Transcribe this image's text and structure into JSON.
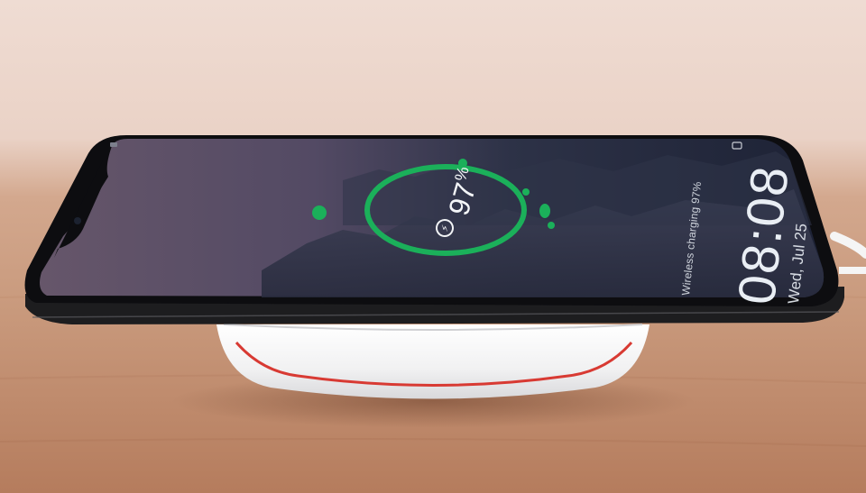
{
  "lockscreen": {
    "charge_percent": "97",
    "percent_sign": "%",
    "charging_text": "Wireless charging 97%",
    "time": "08:08",
    "date": "Wed, Jul 25"
  },
  "icons": [
    "lightning-bolt-icon",
    "camera-icon"
  ],
  "colors": {
    "ring": "#1bb05a",
    "charger_stripe": "#d83a33",
    "charger_body": "#f4f4f5",
    "table": "#c0896b",
    "wall": "#ecd6ca"
  }
}
